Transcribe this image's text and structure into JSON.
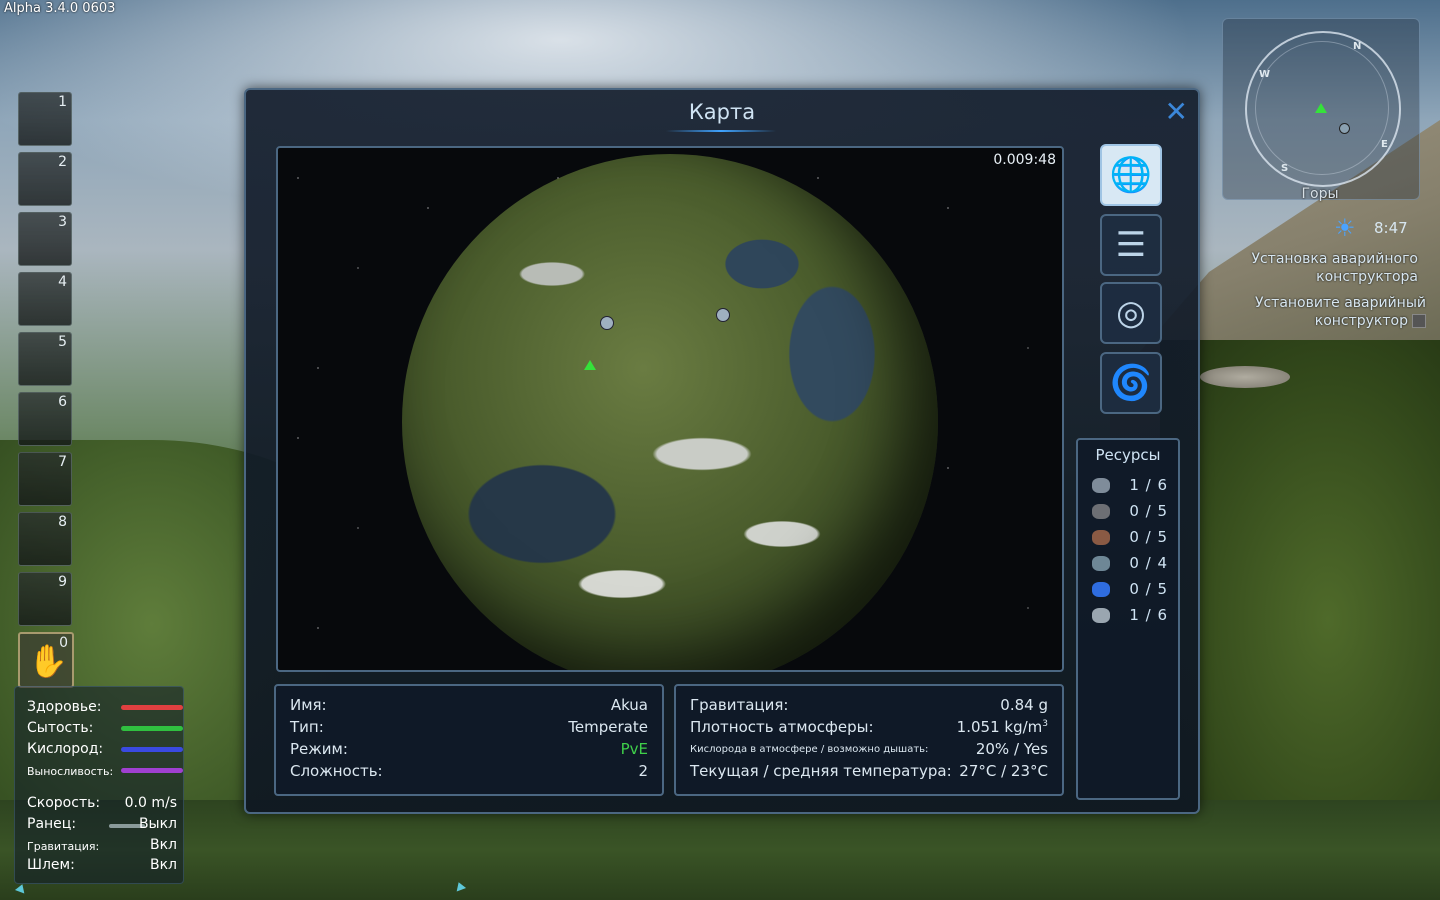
{
  "version": "Alpha 3.4.0 0603",
  "hotbar": [
    "1",
    "2",
    "3",
    "4",
    "5",
    "6",
    "7",
    "8",
    "9",
    "0"
  ],
  "stats": {
    "health_label": "Здоровье:",
    "food_label": "Сытость:",
    "oxygen_label": "Кислород:",
    "stamina_label": "Выносливость:",
    "health_color": "#e04040",
    "food_color": "#30c040",
    "oxygen_color": "#3a4ae0",
    "stamina_color": "#a040d0",
    "speed_label": "Скорость:",
    "speed_value": "0.0 m/s",
    "jetpack_label": "Ранец:",
    "jetpack_value": "Выкл",
    "gravity_label": "Гравитация:",
    "gravity_value": "Вкл",
    "helmet_label": "Шлем:",
    "helmet_value": "Вкл"
  },
  "minimap": {
    "dirs": [
      "N",
      "W",
      "E",
      "S"
    ],
    "biome": "Горы",
    "time": "8:47"
  },
  "quests": {
    "q1_line1": "Установка аварийного",
    "q1_line2": "конструктора",
    "q2_line1": "Установите аварийный",
    "q2_line2": "конструктор"
  },
  "window": {
    "title": "Карта",
    "timer": "0.009:48"
  },
  "side_buttons": [
    "globe-icon",
    "list-icon",
    "solar-system-icon",
    "galaxy-icon"
  ],
  "resources": {
    "title": "Ресурсы",
    "items": [
      {
        "value": "1 / 6",
        "color": "#7f8c9a"
      },
      {
        "value": "0 / 5",
        "color": "#6d6f74"
      },
      {
        "value": "0 / 5",
        "color": "#8a5a44"
      },
      {
        "value": "0 / 4",
        "color": "#6e8796"
      },
      {
        "value": "0 / 5",
        "color": "#2f6de0"
      },
      {
        "value": "1 / 6",
        "color": "#9aa6b0"
      }
    ]
  },
  "planet_info": {
    "name_label": "Имя:",
    "name_value": "Akua",
    "type_label": "Тип:",
    "type_value": "Temperate",
    "mode_label": "Режим:",
    "mode_value": "PvE",
    "difficulty_label": "Сложность:",
    "difficulty_value": "2"
  },
  "env_info": {
    "gravity_label": "Гравитация:",
    "gravity_value": "0.84 g",
    "density_label": "Плотность атмосферы:",
    "density_value": "1.051 kg/m",
    "density_exp": "3",
    "oxygen_label": "Кислорода в атмосфере / возможно дышать:",
    "oxygen_value": "20% / Yes",
    "temp_label": "Текущая / средняя температура:",
    "temp_value": "27°C / 23°C"
  }
}
